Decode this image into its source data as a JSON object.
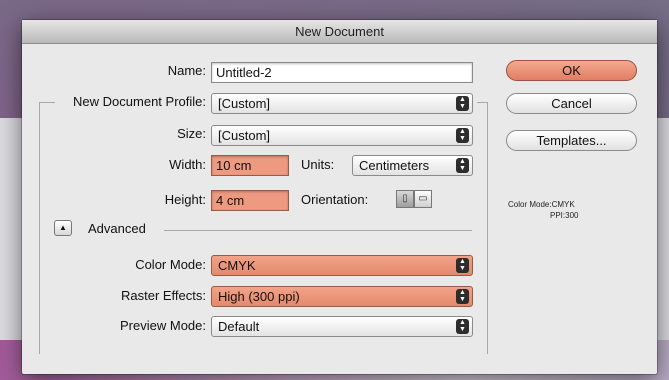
{
  "dialog": {
    "title": "New Document",
    "name_label": "Name:",
    "name_value": "Untitled-2",
    "profile_label": "New Document Profile:",
    "profile_value": "[Custom]",
    "size_label": "Size:",
    "size_value": "[Custom]",
    "width_label": "Width:",
    "width_value": "10 cm",
    "units_label": "Units:",
    "units_value": "Centimeters",
    "height_label": "Height:",
    "height_value": "4 cm",
    "orientation_label": "Orientation:",
    "advanced_label": "Advanced",
    "color_mode_label": "Color Mode:",
    "color_mode_value": "CMYK",
    "raster_label": "Raster Effects:",
    "raster_value": "High (300 ppi)",
    "preview_label": "Preview Mode:",
    "preview_value": "Default"
  },
  "buttons": {
    "ok": "OK",
    "cancel": "Cancel",
    "templates": "Templates..."
  },
  "info": {
    "color_mode": "Color Mode:CMYK",
    "ppi": "PPI:300"
  },
  "colors": {
    "highlight": "#ee9a80",
    "dialog_bg": "#e9e9e9"
  },
  "icons": {
    "select_arrows": "up-down-arrows-icon",
    "portrait": "portrait-orientation-icon",
    "landscape": "landscape-orientation-icon",
    "disclosure": "triangle-up-icon"
  }
}
